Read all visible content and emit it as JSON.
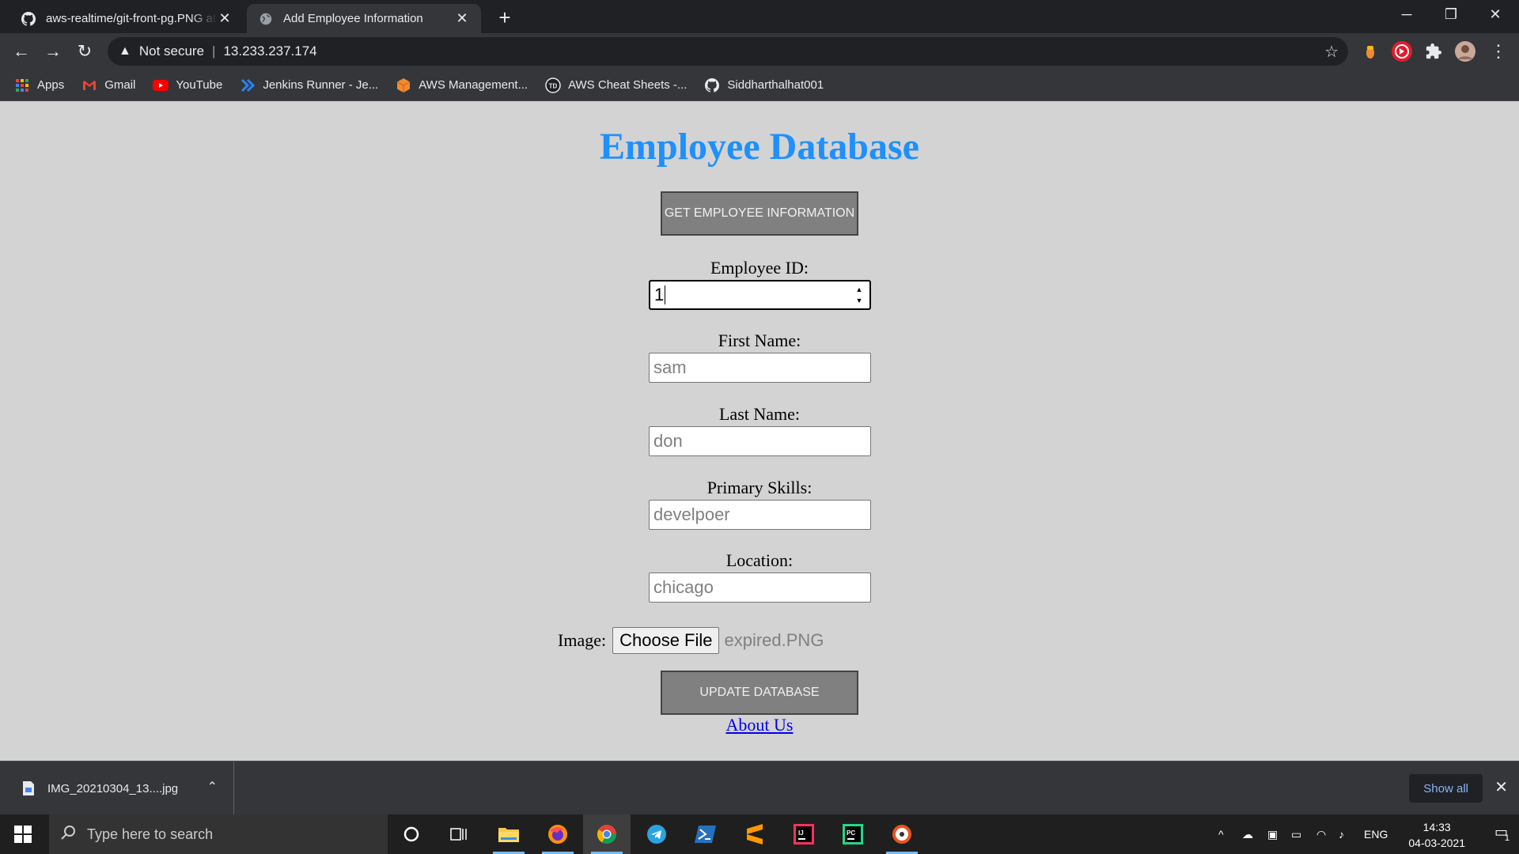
{
  "browser": {
    "tabs": [
      {
        "title": "aws-realtime/git-front-pg.PNG at",
        "favicon": "github-icon",
        "active": false
      },
      {
        "title": "Add Employee Information",
        "favicon": "globe-icon",
        "active": true
      }
    ],
    "security_label": "Not secure",
    "url": "13.233.237.174",
    "bookmarks": [
      {
        "label": "Apps",
        "icon": "apps-grid-icon"
      },
      {
        "label": "Gmail",
        "icon": "gmail-icon"
      },
      {
        "label": "YouTube",
        "icon": "youtube-icon"
      },
      {
        "label": "Jenkins Runner - Je...",
        "icon": "jenkins-runner-icon"
      },
      {
        "label": "AWS Management...",
        "icon": "aws-box-icon"
      },
      {
        "label": "AWS Cheat Sheets -...",
        "icon": "tutorialsdojo-icon"
      },
      {
        "label": "Siddharthalhat001",
        "icon": "github-icon"
      }
    ]
  },
  "page": {
    "title": "Employee Database",
    "get_button": "GET EMPLOYEE INFORMATION",
    "fields": {
      "employee_id": {
        "label": "Employee ID:",
        "value": "1"
      },
      "first_name": {
        "label": "First Name:",
        "value": "sam"
      },
      "last_name": {
        "label": "Last Name:",
        "value": "don"
      },
      "primary_skills": {
        "label": "Primary Skills:",
        "value": "develpoer"
      },
      "location": {
        "label": "Location:",
        "value": "chicago"
      }
    },
    "image": {
      "label": "Image:",
      "button": "Choose File",
      "filename": "expired.PNG"
    },
    "update_button": "UPDATE DATABASE",
    "about_link": "About Us",
    "colors": {
      "background": "#d3d3d3",
      "title": "#1e90ff",
      "button": "#808080",
      "link": "#0000ee"
    }
  },
  "downloads": {
    "file": "IMG_20210304_13....jpg",
    "show_all": "Show all"
  },
  "taskbar": {
    "search_placeholder": "Type here to search",
    "language": "ENG",
    "time": "14:33",
    "date": "04-03-2021",
    "notification_count": "1"
  }
}
